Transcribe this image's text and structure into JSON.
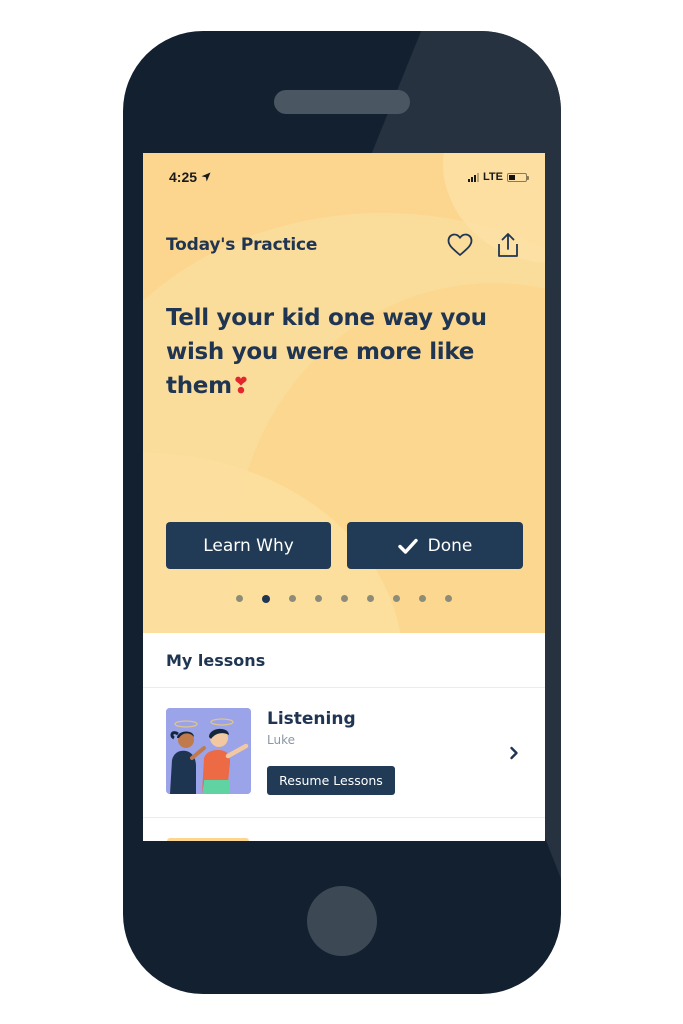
{
  "status_bar": {
    "time": "4:25",
    "network": "LTE",
    "icons": [
      "location-arrow-icon",
      "signal-bars-icon",
      "battery-icon"
    ]
  },
  "hero": {
    "title": "Today's Practice",
    "actions": [
      {
        "name": "favorite",
        "icon": "heart-outline-icon"
      },
      {
        "name": "share",
        "icon": "share-icon"
      }
    ],
    "prompt": "Tell your kid one way you wish you were more like them",
    "prompt_emoji": "❣",
    "buttons": {
      "learn_why": "Learn Why",
      "done": "Done",
      "done_icon": "checkmark-icon"
    },
    "pagination": {
      "total": 9,
      "active_index": 1
    },
    "colors": {
      "background": "#fcd68f",
      "text": "#1f3552",
      "button": "#213a56",
      "emoji": "#e3262d"
    }
  },
  "lessons": {
    "header": "My lessons",
    "items": [
      {
        "title": "Listening",
        "subtitle": "Luke",
        "button": "Resume Lessons",
        "thumbnail": "two-kids-with-halos-illustration",
        "chevron_icon": "chevron-right-icon"
      }
    ]
  }
}
